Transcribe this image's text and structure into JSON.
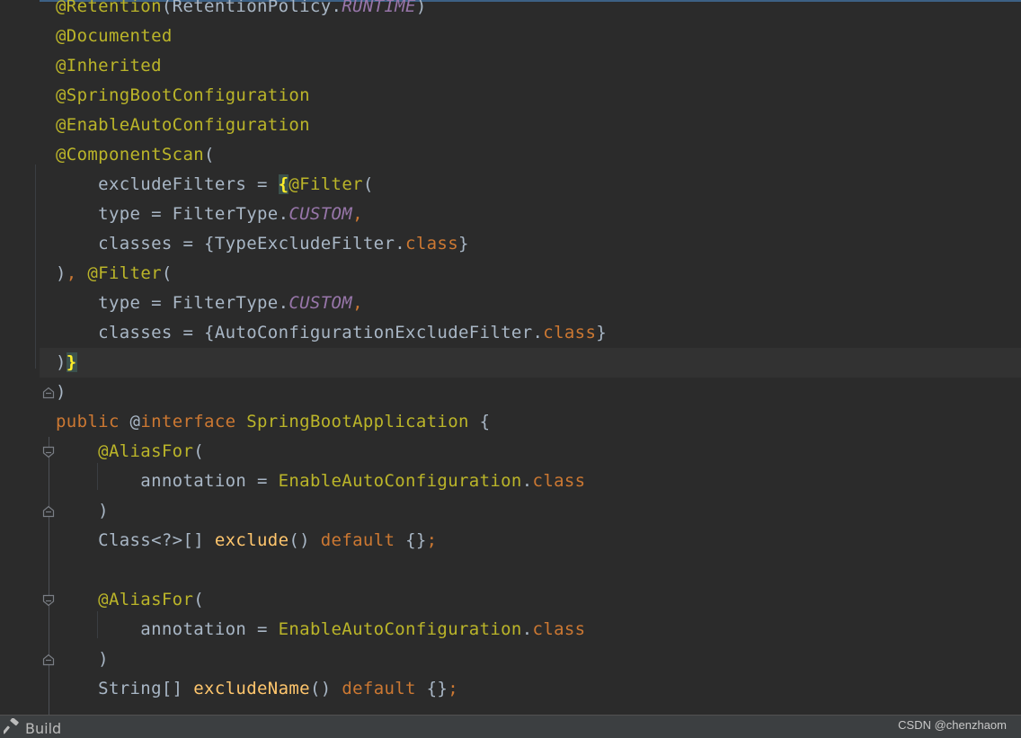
{
  "editor": {
    "lines": [
      {
        "tokens": [
          {
            "t": "@Retention",
            "c": "anno"
          },
          {
            "t": "(RetentionPolicy.",
            "c": "plain"
          },
          {
            "t": "RUNTIME",
            "c": "const"
          },
          {
            "t": ")",
            "c": "plain"
          }
        ]
      },
      {
        "tokens": [
          {
            "t": "@Documented",
            "c": "anno"
          }
        ]
      },
      {
        "tokens": [
          {
            "t": "@Inherited",
            "c": "anno"
          }
        ]
      },
      {
        "tokens": [
          {
            "t": "@SpringBootConfiguration",
            "c": "anno"
          }
        ]
      },
      {
        "tokens": [
          {
            "t": "@EnableAutoConfiguration",
            "c": "anno"
          }
        ]
      },
      {
        "tokens": [
          {
            "t": "@ComponentScan",
            "c": "anno"
          },
          {
            "t": "(",
            "c": "plain"
          }
        ]
      },
      {
        "tokens": [
          {
            "t": "    excludeFilters = ",
            "c": "plain"
          },
          {
            "t": "{",
            "c": "brace"
          },
          {
            "t": "@Filter",
            "c": "anno"
          },
          {
            "t": "(",
            "c": "plain"
          }
        ]
      },
      {
        "tokens": [
          {
            "t": "    type = FilterType.",
            "c": "plain"
          },
          {
            "t": "CUSTOM",
            "c": "const"
          },
          {
            "t": ",",
            "c": "kw"
          }
        ]
      },
      {
        "tokens": [
          {
            "t": "    classes = {TypeExcludeFilter.",
            "c": "plain"
          },
          {
            "t": "class",
            "c": "kw"
          },
          {
            "t": "}",
            "c": "plain"
          }
        ]
      },
      {
        "tokens": [
          {
            "t": ")",
            "c": "plain"
          },
          {
            "t": ", ",
            "c": "kw"
          },
          {
            "t": "@Filter",
            "c": "anno"
          },
          {
            "t": "(",
            "c": "plain"
          }
        ]
      },
      {
        "tokens": [
          {
            "t": "    type = FilterType.",
            "c": "plain"
          },
          {
            "t": "CUSTOM",
            "c": "const"
          },
          {
            "t": ",",
            "c": "kw"
          }
        ]
      },
      {
        "tokens": [
          {
            "t": "    classes = {AutoConfigurationExcludeFilter.",
            "c": "plain"
          },
          {
            "t": "class",
            "c": "kw"
          },
          {
            "t": "}",
            "c": "plain"
          }
        ]
      },
      {
        "current": true,
        "tokens": [
          {
            "t": ")",
            "c": "plain"
          },
          {
            "t": "}",
            "c": "brace"
          }
        ]
      },
      {
        "tokens": [
          {
            "t": ")",
            "c": "plain"
          }
        ]
      },
      {
        "tokens": [
          {
            "t": "public ",
            "c": "kw"
          },
          {
            "t": "@",
            "c": "plain"
          },
          {
            "t": "interface ",
            "c": "kw"
          },
          {
            "t": "SpringBootApplication",
            "c": "cls"
          },
          {
            "t": " {",
            "c": "plain"
          }
        ]
      },
      {
        "tokens": [
          {
            "t": "    ",
            "c": "plain"
          },
          {
            "t": "@AliasFor",
            "c": "anno"
          },
          {
            "t": "(",
            "c": "plain"
          }
        ]
      },
      {
        "tokens": [
          {
            "t": "        annotation = ",
            "c": "plain"
          },
          {
            "t": "EnableAutoConfiguration",
            "c": "cls"
          },
          {
            "t": ".",
            "c": "plain"
          },
          {
            "t": "class",
            "c": "kw"
          }
        ]
      },
      {
        "tokens": [
          {
            "t": "    )",
            "c": "plain"
          }
        ]
      },
      {
        "tokens": [
          {
            "t": "    Class<?>[] ",
            "c": "plain"
          },
          {
            "t": "exclude",
            "c": "fn"
          },
          {
            "t": "() ",
            "c": "plain"
          },
          {
            "t": "default",
            "c": "kw"
          },
          {
            "t": " {}",
            "c": "plain"
          },
          {
            "t": ";",
            "c": "kw"
          }
        ]
      },
      {
        "tokens": [
          {
            "t": "",
            "c": "plain"
          }
        ]
      },
      {
        "tokens": [
          {
            "t": "    ",
            "c": "plain"
          },
          {
            "t": "@AliasFor",
            "c": "anno"
          },
          {
            "t": "(",
            "c": "plain"
          }
        ]
      },
      {
        "tokens": [
          {
            "t": "        annotation = ",
            "c": "plain"
          },
          {
            "t": "EnableAutoConfiguration",
            "c": "cls"
          },
          {
            "t": ".",
            "c": "plain"
          },
          {
            "t": "class",
            "c": "kw"
          }
        ]
      },
      {
        "tokens": [
          {
            "t": "    )",
            "c": "plain"
          }
        ]
      },
      {
        "tokens": [
          {
            "t": "    String[] ",
            "c": "plain"
          },
          {
            "t": "excludeName",
            "c": "fn"
          },
          {
            "t": "() ",
            "c": "plain"
          },
          {
            "t": "default",
            "c": "kw"
          },
          {
            "t": " {}",
            "c": "plain"
          },
          {
            "t": ";",
            "c": "kw"
          }
        ]
      }
    ],
    "fold_markers": [
      {
        "line": 13,
        "kind": "end"
      },
      {
        "line": 15,
        "kind": "start"
      },
      {
        "line": 17,
        "kind": "end"
      },
      {
        "line": 20,
        "kind": "start"
      },
      {
        "line": 22,
        "kind": "end"
      }
    ]
  },
  "statusbar": {
    "build_label": "Build",
    "build_icon": "hammer-icon",
    "watermark": "CSDN @chenzhaom"
  },
  "colors": {
    "background": "#2b2b2b",
    "annotation": "#bbb529",
    "keyword": "#cc7832",
    "constant": "#9876aa",
    "plain": "#a9b7c6",
    "method": "#ffc66d",
    "brace_highlight": "#ffef28"
  }
}
